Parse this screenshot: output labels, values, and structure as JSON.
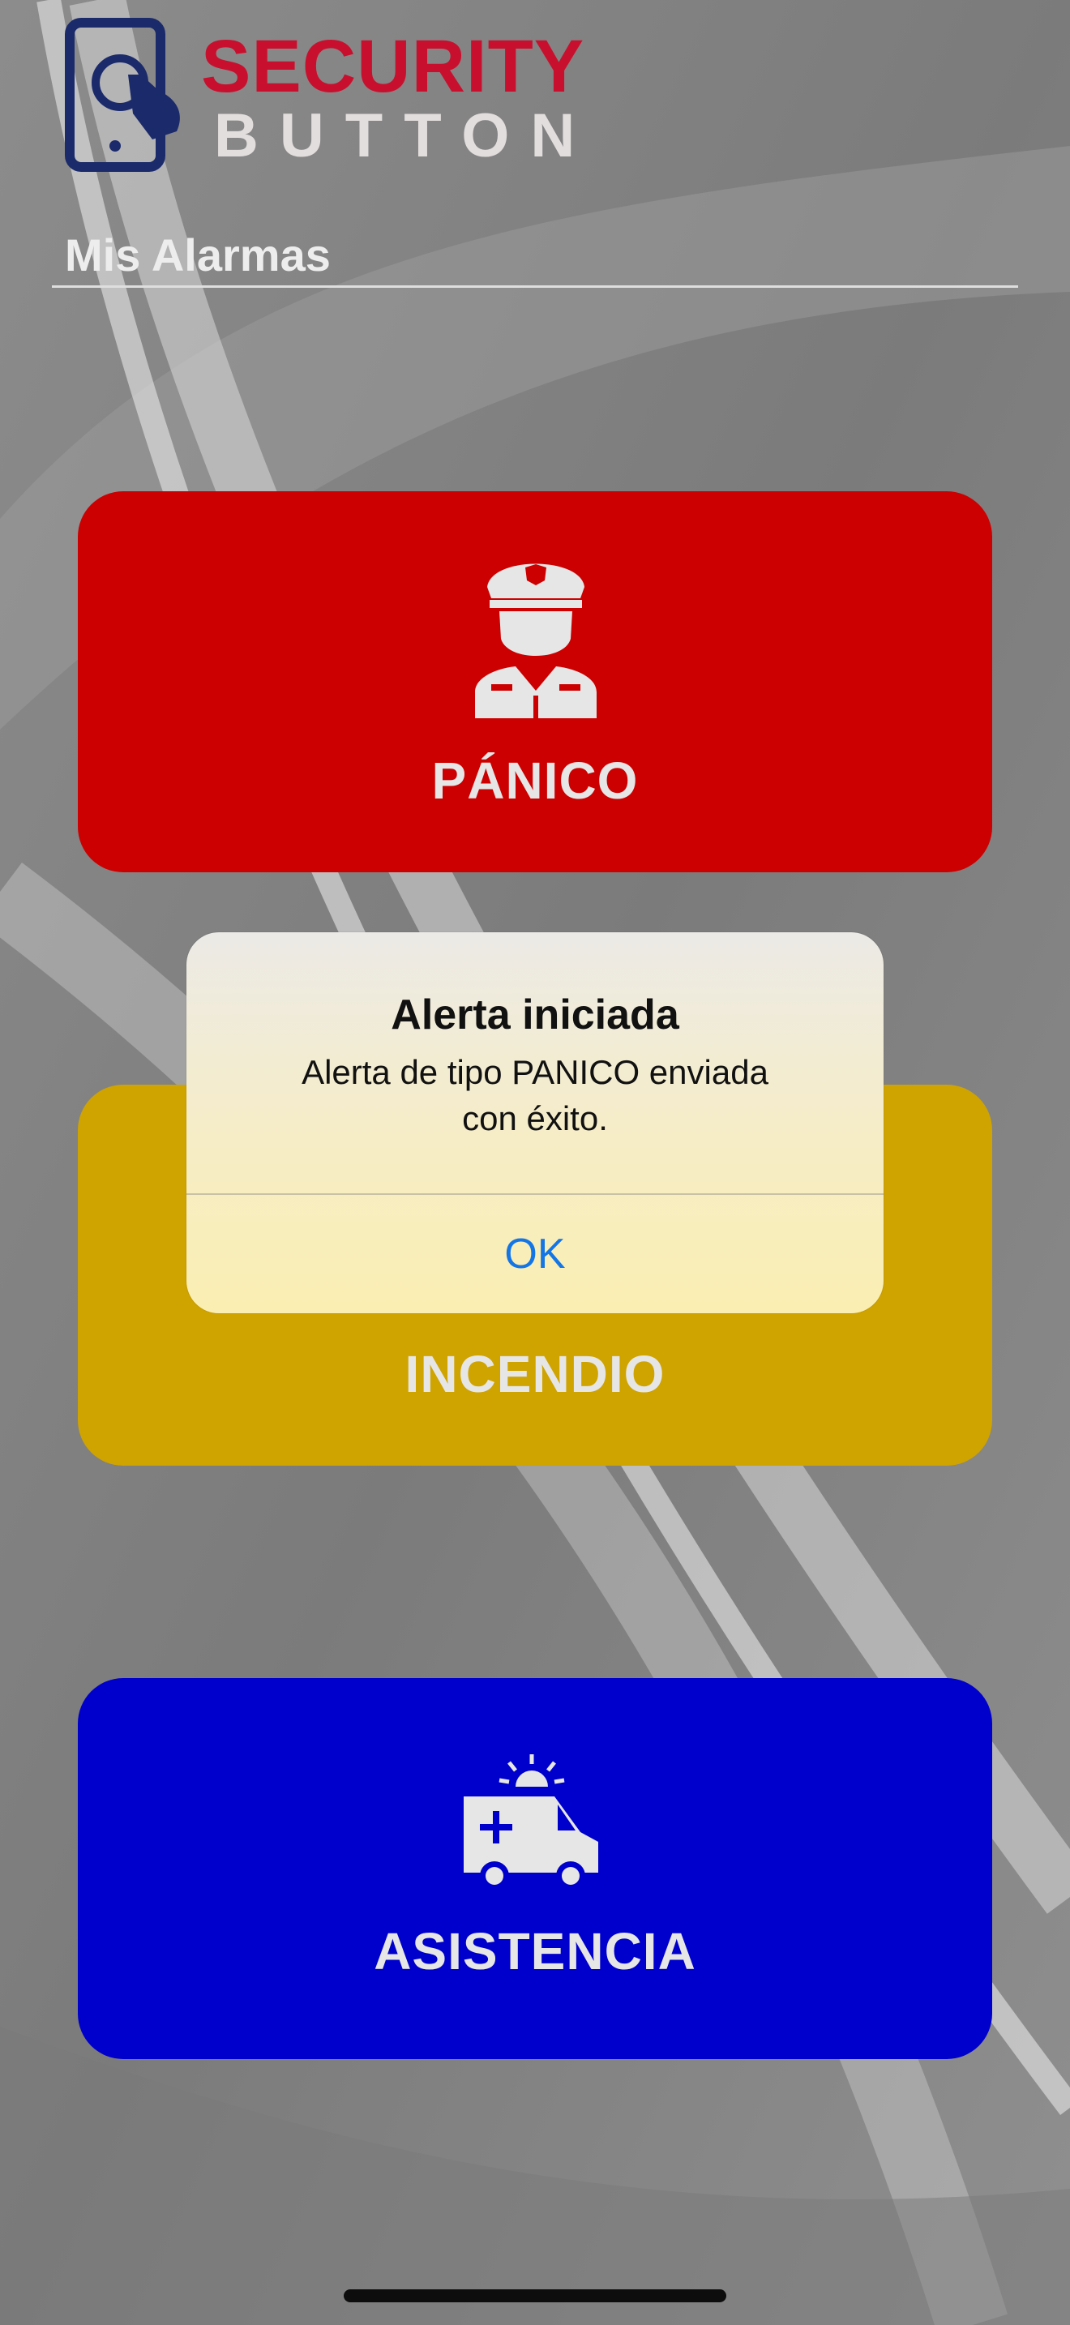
{
  "app": {
    "logo_line1": "SECURITY",
    "logo_line2": "BUTTON",
    "logo_icon": "phone-touch-icon",
    "logo_colors": {
      "primary": "#1b2a6b",
      "accent": "#c8102e"
    }
  },
  "section": {
    "title": "Mis Alarmas"
  },
  "alarms": [
    {
      "label": "PÁNICO",
      "icon": "security-guard-icon",
      "color": "#cc0000"
    },
    {
      "label": "INCENDIO",
      "icon": "fire-icon",
      "color": "#cfa300"
    },
    {
      "label": "ASISTENCIA",
      "icon": "ambulance-icon",
      "color": "#0000cc"
    }
  ],
  "dialog": {
    "title": "Alerta iniciada",
    "message_line1": "Alerta de tipo PANICO enviada",
    "message_line2": "con éxito.",
    "ok_label": "OK",
    "ok_color": "#1476e6"
  }
}
